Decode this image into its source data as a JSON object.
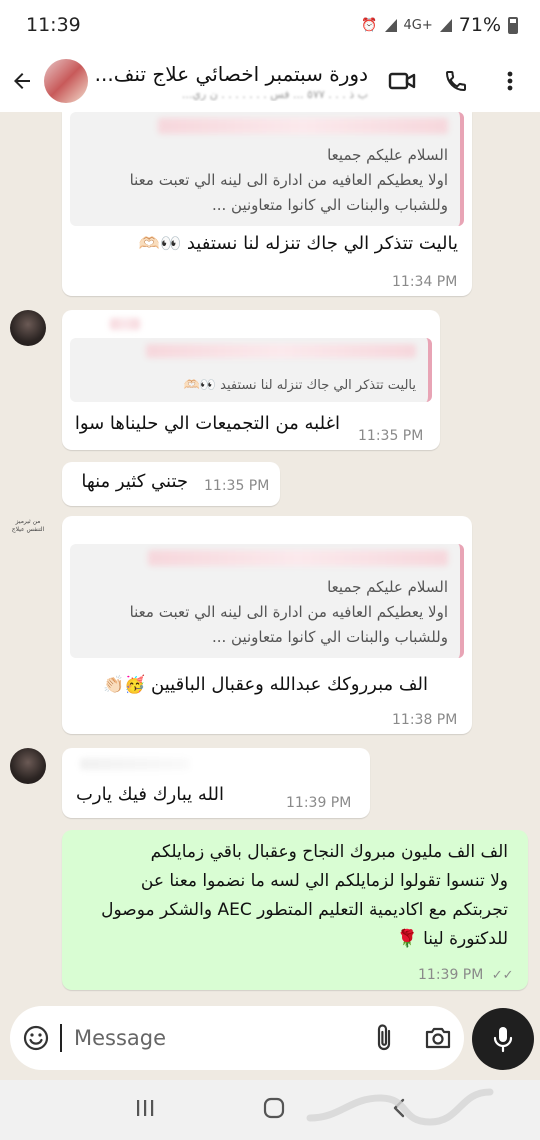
{
  "status": {
    "time": "11:39",
    "network": "4G+",
    "battery": "71%"
  },
  "header": {
    "title": "دورة سبتمبر اخصائي علاج تنف...",
    "subtitle": "ب ذ . . . ٥٧٧ ... فس . . . . . . . ن ري..."
  },
  "messages": [
    {
      "quote_lines": [
        "السلام عليكم جميعا",
        "اولا يعطيكم العافيه من ادارة الى لينه الي تعبت معنا",
        "وللشباب والبنات الي كانوا متعاونين ..."
      ],
      "text": "ياليت تتذكر الي جاك تنزله لنا نستفيد",
      "emoji": "👀🫶🏻",
      "time": "11:34 PM"
    },
    {
      "quote_lines": [
        "ياليت تتذكر الي جاك تنزله لنا نستفيد 👀🫶🏻"
      ],
      "text": "اغلبه من التجميعات الي حليناها سوا",
      "time": "11:35 PM"
    },
    {
      "text": "جتني كثير منها",
      "time": "11:35 PM"
    },
    {
      "sender_logo": "من ثيرميز التنفس عيلاج",
      "quote_lines": [
        "السلام عليكم جميعا",
        "اولا يعطيكم العافيه من ادارة الى لينه الي تعبت معنا",
        "وللشباب والبنات الي كانوا متعاونين ..."
      ],
      "text": "الف مبرروكك عبدالله وعقبال الباقيين",
      "emoji": "🥳👏🏻",
      "time": "11:38 PM"
    },
    {
      "text": "الله يبارك فيك يارب",
      "time": "11:39 PM"
    },
    {
      "lines": [
        "الف الف مليون مبروك النجاح وعقبال باقي زمايلكم",
        "ولا تنسوا تقولوا لزمايلكم الي لسه ما نضموا معنا عن",
        "تجربتكم مع اكاديمية التعليم المتطور AEC والشكر موصول",
        "للدكتورة لينا 🌹"
      ],
      "time": "11:39 PM",
      "ticks": "✓✓"
    }
  ],
  "input": {
    "placeholder": "Message"
  },
  "colors": {
    "outgoing": "#d9fdd3",
    "incoming": "#ffffff",
    "chat_bg": "#efeae2",
    "quote_bar": "#e8a4b5"
  },
  "icons": [
    "back-arrow-icon",
    "video-call-icon",
    "phone-icon",
    "more-vert-icon",
    "emoji-icon",
    "attach-icon",
    "camera-icon",
    "mic-icon",
    "nav-recents-icon",
    "nav-home-icon",
    "nav-back-icon"
  ]
}
